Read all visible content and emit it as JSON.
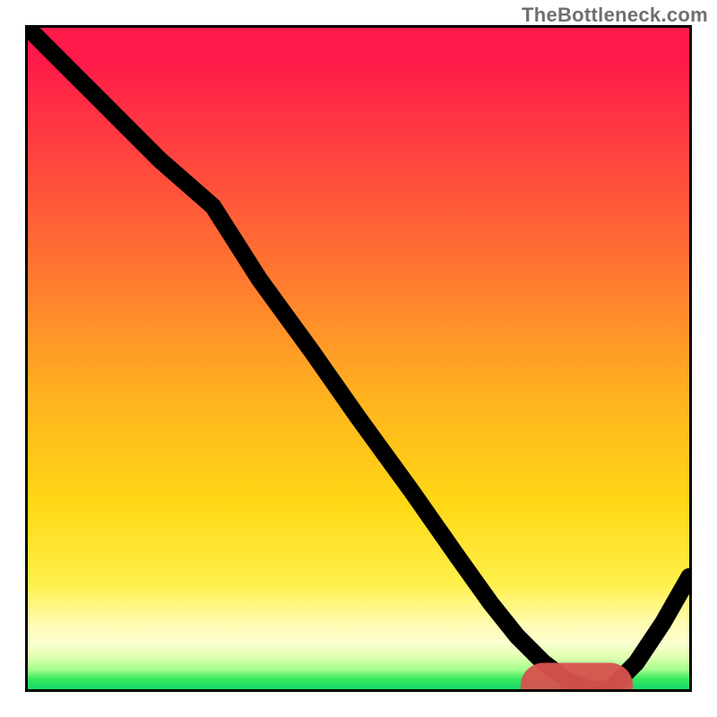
{
  "attribution": "TheBottleneck.com",
  "chart_data": {
    "type": "line",
    "title": "",
    "xlabel": "",
    "ylabel": "",
    "xlim": [
      0,
      100
    ],
    "ylim": [
      0,
      100
    ],
    "x": [
      0,
      6,
      13,
      20,
      28,
      35,
      43,
      50,
      58,
      65,
      70,
      74,
      78,
      82,
      85,
      88,
      92,
      96,
      100
    ],
    "values": [
      100,
      94,
      87,
      80,
      73,
      62,
      51,
      41,
      30,
      20,
      13,
      8,
      4,
      1,
      0,
      0,
      4,
      10,
      17
    ],
    "gradient_stops": [
      {
        "pos": 0,
        "color": "#ff1a49"
      },
      {
        "pos": 0.05,
        "color": "#ff1a49"
      },
      {
        "pos": 0.18,
        "color": "#ff4040"
      },
      {
        "pos": 0.38,
        "color": "#ff7a30"
      },
      {
        "pos": 0.55,
        "color": "#ffb020"
      },
      {
        "pos": 0.72,
        "color": "#ffd815"
      },
      {
        "pos": 0.84,
        "color": "#fff04a"
      },
      {
        "pos": 0.9,
        "color": "#fffbb0"
      },
      {
        "pos": 0.93,
        "color": "#fbffd0"
      },
      {
        "pos": 0.95,
        "color": "#e2ffb3"
      },
      {
        "pos": 0.97,
        "color": "#a7ff8f"
      },
      {
        "pos": 0.985,
        "color": "#35e85e"
      },
      {
        "pos": 1.0,
        "color": "#19d86b"
      }
    ],
    "marker_band": {
      "x_start": 78,
      "x_end": 88,
      "y": 0.5,
      "color": "#d9534f"
    }
  }
}
